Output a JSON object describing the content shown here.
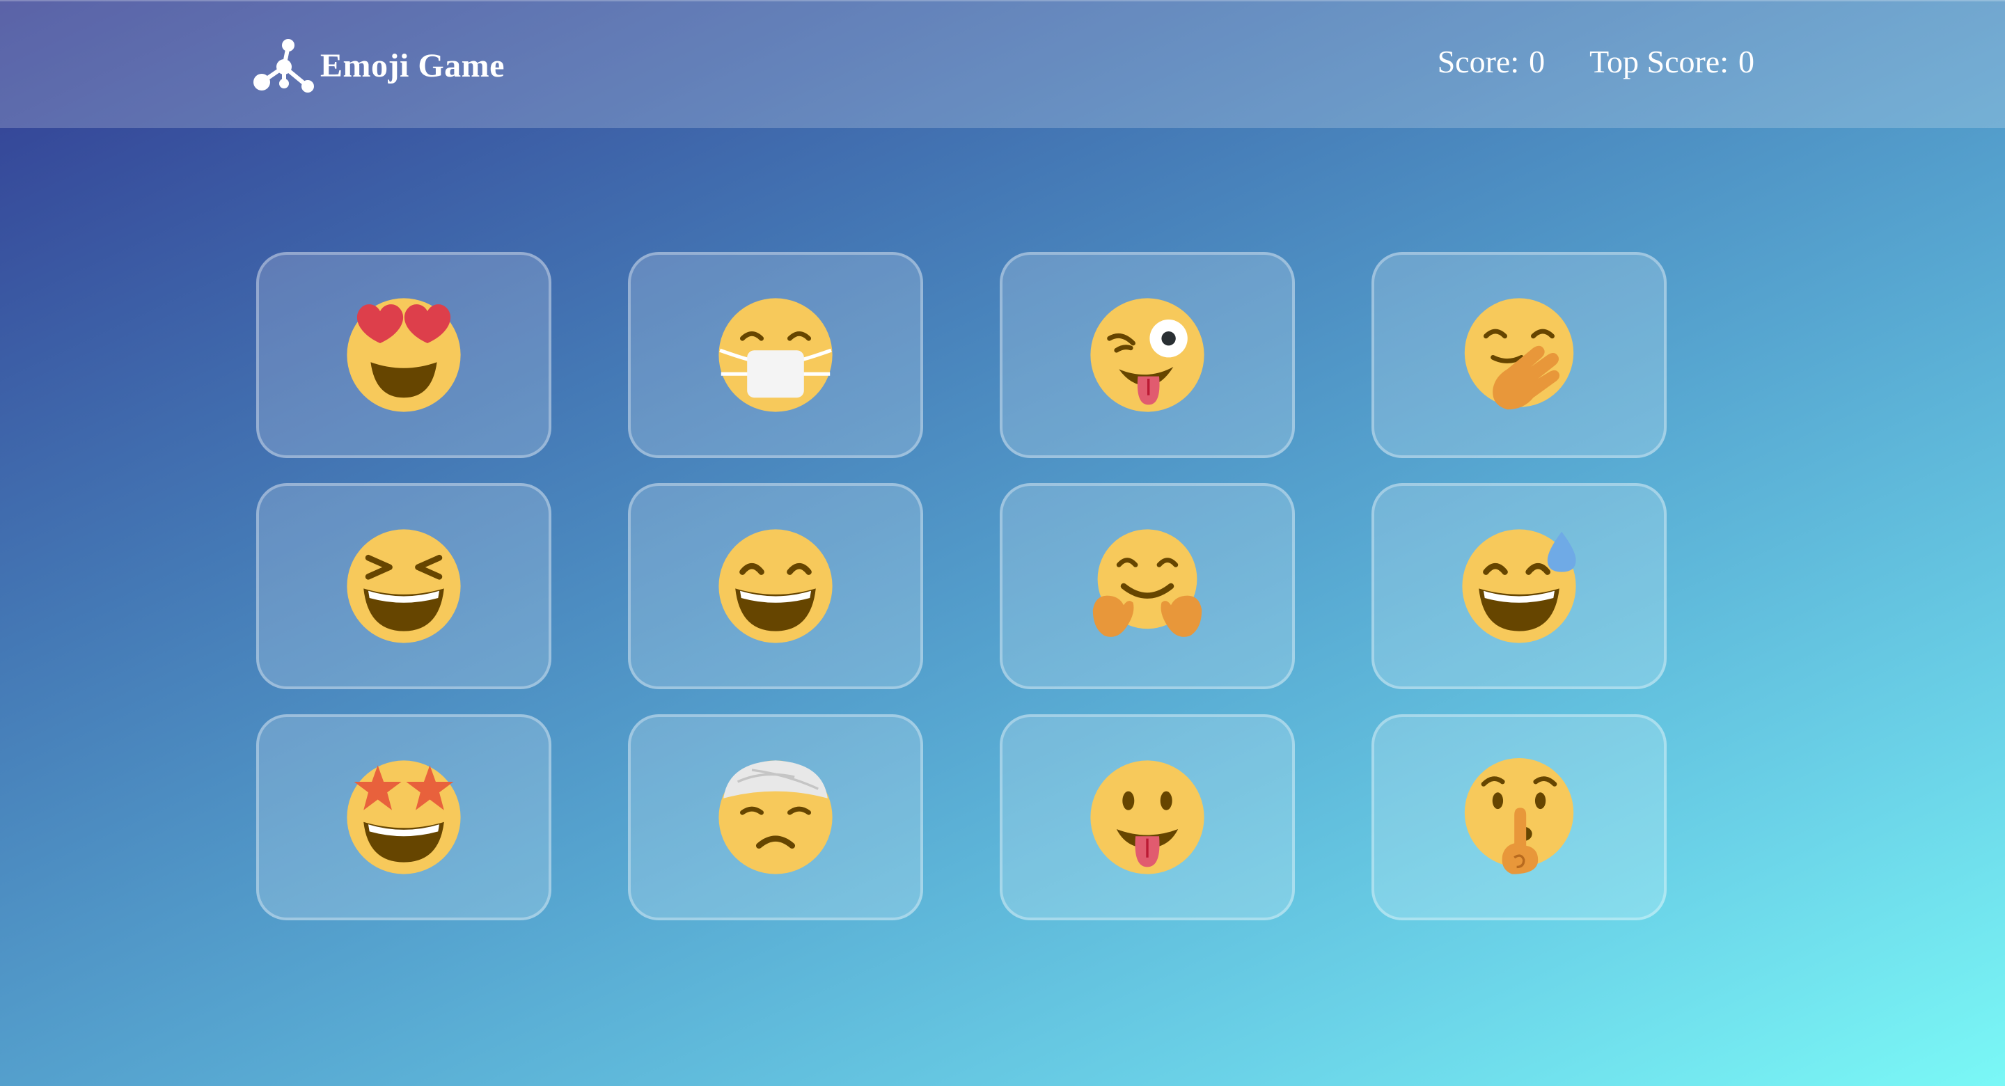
{
  "header": {
    "title": "Emoji Game",
    "logo_icon": "molecule-logo-icon",
    "score_label": "Score:",
    "score_value": "0",
    "top_score_label": "Top Score:",
    "top_score_value": "0"
  },
  "emojis": [
    {
      "name": "heart-eyes-emoji-icon"
    },
    {
      "name": "face-with-medical-mask-emoji-icon"
    },
    {
      "name": "winking-face-with-tongue-emoji-icon"
    },
    {
      "name": "face-with-hand-over-mouth-emoji-icon"
    },
    {
      "name": "grinning-squinting-face-emoji-icon"
    },
    {
      "name": "grinning-face-with-smiling-eyes-emoji-icon"
    },
    {
      "name": "hugging-face-emoji-icon"
    },
    {
      "name": "grinning-face-with-sweat-emoji-icon"
    },
    {
      "name": "star-struck-emoji-icon"
    },
    {
      "name": "face-with-head-bandage-emoji-icon"
    },
    {
      "name": "face-with-tongue-emoji-icon"
    },
    {
      "name": "shushing-face-emoji-icon"
    }
  ],
  "colors": {
    "face": "#F7C95B",
    "feature": "#664500",
    "heart": "#DD3F4B",
    "tongue": "#E15B6F",
    "hand": "#E8973A",
    "star": "#E8613C",
    "sweat": "#6FAAE6"
  }
}
